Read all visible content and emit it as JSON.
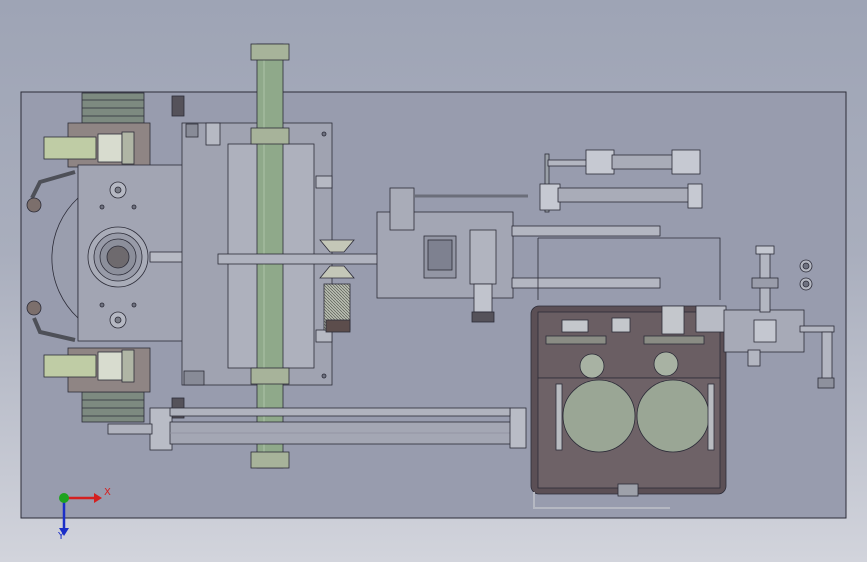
{
  "viewport": {
    "background_top": "#9ea4b5",
    "background_bottom": "#d2d4dc",
    "plate_color": "#989cae",
    "part_color": "#a6a8b6",
    "edge_color": "#2c2c38",
    "accent_green": "#8fa98a",
    "cabinet_color": "#5b4f55"
  },
  "triad": {
    "x_label": "X",
    "y_label": "Y",
    "x_color": "#d42020",
    "y_color": "#1a2ec8",
    "origin_color": "#1fa31f"
  }
}
